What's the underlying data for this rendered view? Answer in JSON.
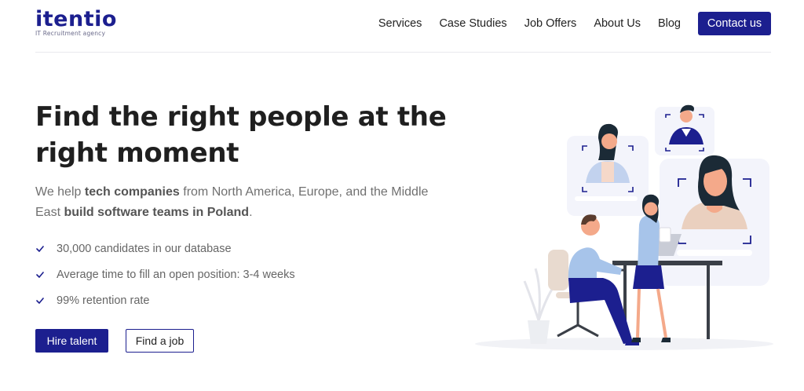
{
  "brand": {
    "name": "itentio",
    "tagline": "IT Recruitment agency",
    "color": "#1c1f8f"
  },
  "nav": {
    "items": [
      "Services",
      "Case Studies",
      "Job Offers",
      "About Us",
      "Blog"
    ],
    "contact_label": "Contact us"
  },
  "hero": {
    "title_part1": "Find the ",
    "title_bold1": "right people",
    "title_part2": " at the ",
    "title_bold2": "right moment",
    "desc_part1": "We help ",
    "desc_bold1": "tech companies",
    "desc_part2": " from North America, Europe, and the Middle East ",
    "desc_bold2": "build software teams in Poland",
    "desc_part3": "."
  },
  "features": [
    "30,000 candidates in our database",
    "Average time to fill an open position: 3-4 weeks",
    "99% retention rate"
  ],
  "cta": {
    "primary_label": "Hire talent",
    "secondary_label": "Find a job"
  },
  "icons": {
    "check": "check-icon",
    "illustration": "recruitment-illustration"
  }
}
